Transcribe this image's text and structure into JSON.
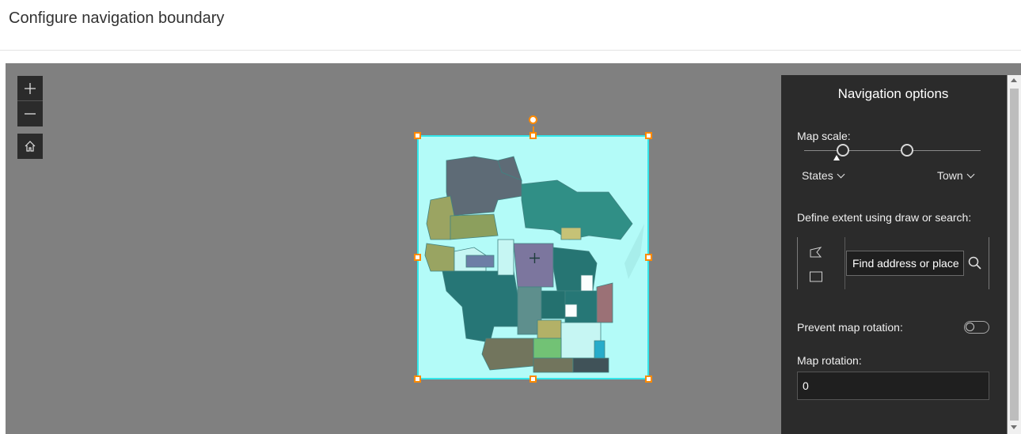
{
  "header": {
    "title": "Configure navigation boundary"
  },
  "map": {
    "zoom_in_label": "+",
    "zoom_out_label": "—",
    "center_marker": "+"
  },
  "panel": {
    "title": "Navigation options",
    "map_scale_label": "Map scale:",
    "scale_min": "States",
    "scale_max": "Town",
    "extent_label": "Define extent using draw or search:",
    "search_placeholder": "Find address or place",
    "search_value": "Find address or place",
    "prevent_rotation_label": "Prevent map rotation:",
    "prevent_rotation_on": false,
    "rotation_label": "Map rotation:",
    "rotation_value": "0"
  },
  "icons": {
    "zoom_in": "plus-icon",
    "zoom_out": "minus-icon",
    "home": "home-icon",
    "polygon_tool": "polygon-icon",
    "rectangle_tool": "rectangle-icon",
    "search": "search-icon"
  },
  "colors": {
    "boundary_fill": "#b3fbf8",
    "boundary_stroke": "#33e6ea",
    "handle": "#ff8a00",
    "panel_bg": "#2b2b2b",
    "map_bg": "#808080"
  }
}
